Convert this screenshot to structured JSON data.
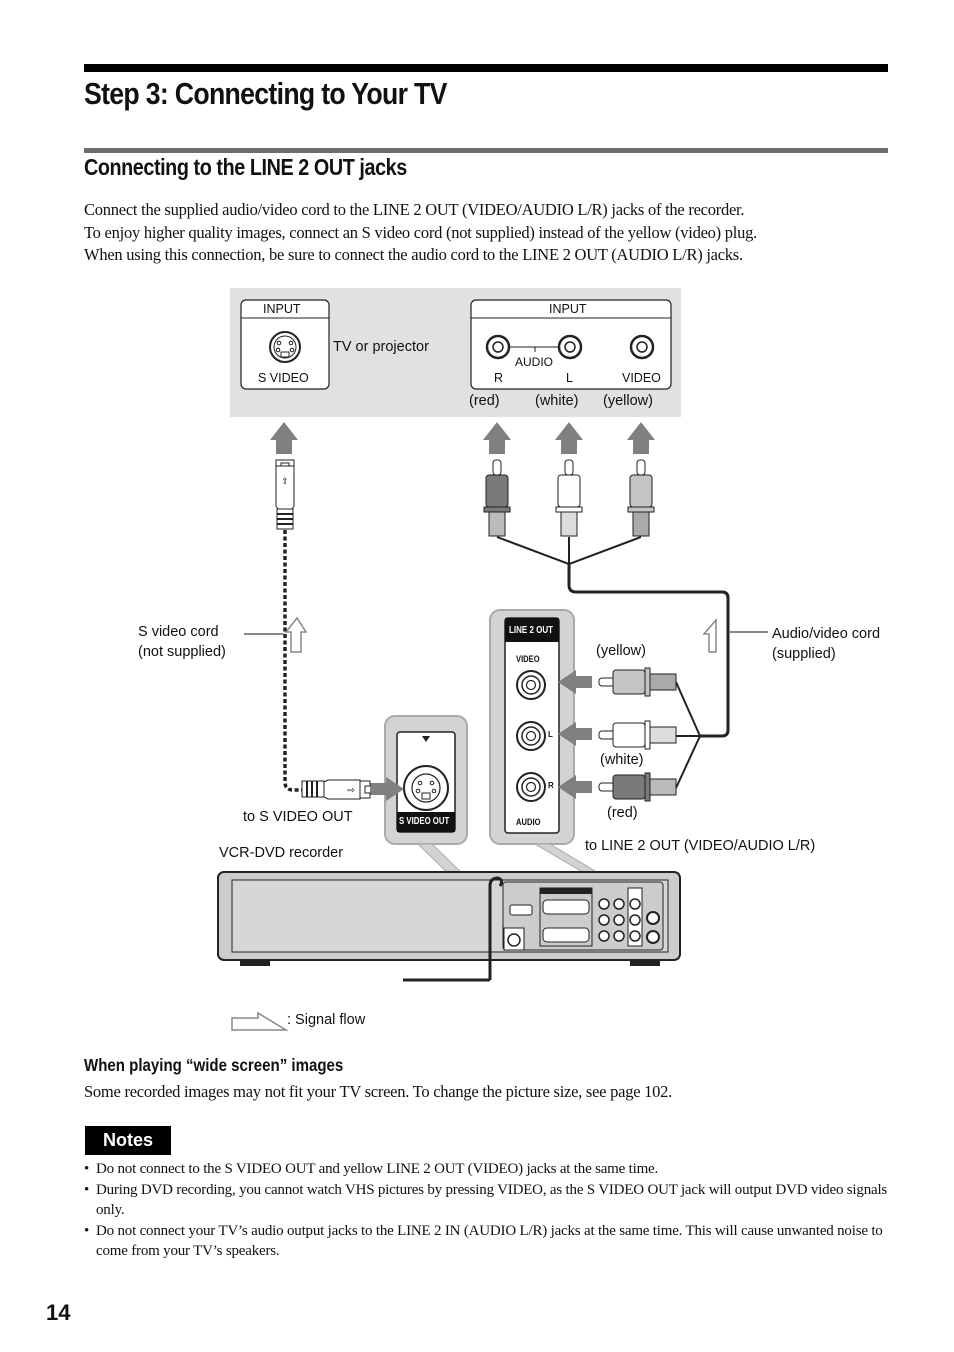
{
  "page": {
    "title": "Step 3: Connecting to Your TV",
    "section_title": "Connecting to the LINE 2 OUT jacks",
    "intro_lines": [
      "Connect the supplied audio/video cord to the LINE 2 OUT (VIDEO/AUDIO L/R) jacks of the recorder.",
      "To enjoy higher quality images, connect an S video cord (not supplied) instead of the yellow (video) plug.",
      "When using this connection, be sure to connect the audio cord to the LINE 2 OUT (AUDIO L/R) jacks."
    ],
    "page_number": "14"
  },
  "diagram": {
    "tv_panel": {
      "s_video_box": {
        "header": "INPUT",
        "jack_label": "S VIDEO"
      },
      "device_label": "TV or projector",
      "av_box": {
        "header": "INPUT",
        "audio_label": "AUDIO",
        "jack_labels": [
          "R",
          "L",
          "VIDEO"
        ],
        "color_labels": [
          "(red)",
          "(white)",
          "(yellow)"
        ]
      }
    },
    "s_video_cord_label": [
      "S video cord",
      "(not supplied)"
    ],
    "av_cord_label": [
      "Audio/video cord",
      "(supplied)"
    ],
    "recorder_line2_panel": {
      "header": "LINE 2 OUT",
      "video_label": "VIDEO",
      "audio_label": "AUDIO",
      "l_label": "L",
      "r_label": "R",
      "plug_colors": [
        "(yellow)",
        "(white)",
        "(red)"
      ]
    },
    "recorder_svideo_panel": {
      "label": "S VIDEO OUT"
    },
    "to_s_video_out": "to S VIDEO OUT",
    "to_line2_out": "to LINE 2 OUT (VIDEO/AUDIO L/R)",
    "recorder_label": "VCR-DVD recorder",
    "legend": ": Signal flow",
    "colors": {
      "red_plug": "#7a7a7a",
      "white_plug": "#ffffff",
      "yellow_plug": "#c4c4c4",
      "panel_bg": "#e1e1e1",
      "arrow": "#7f7f7f"
    }
  },
  "wide_screen": {
    "heading": "When playing “wide screen” images",
    "text": "Some recorded images may not fit your TV screen. To change the picture size, see page 102."
  },
  "notes": {
    "badge": "Notes",
    "items": [
      "Do not connect to the S VIDEO OUT and yellow LINE 2 OUT (VIDEO) jacks at the same time.",
      "During DVD recording, you cannot watch VHS pictures by pressing VIDEO, as the S VIDEO OUT jack will output DVD video signals only.",
      "Do not connect your TV’s audio output jacks to the LINE 2 IN (AUDIO L/R) jacks at the same time. This will cause unwanted noise to come from your TV’s speakers."
    ]
  }
}
